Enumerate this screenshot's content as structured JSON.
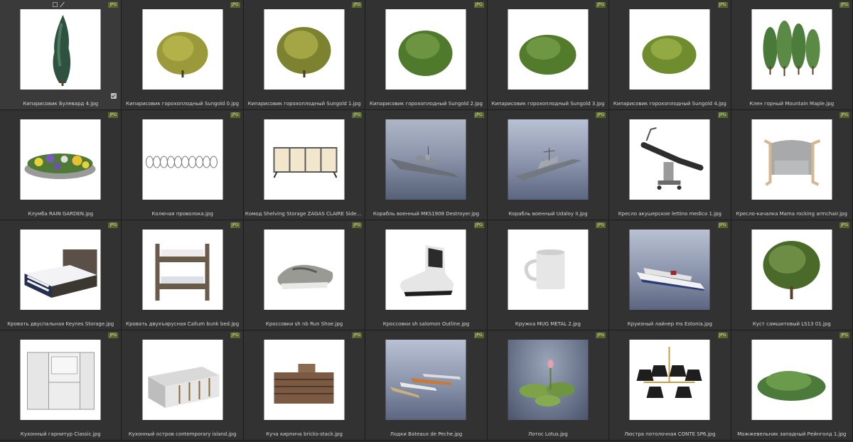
{
  "file_type_badge": "JPG",
  "items": [
    {
      "caption": "Кипарисовик Булевард 4.jpg",
      "icon": "cypress-tree-image"
    },
    {
      "caption": "Кипарисовик горохоплодный Sungold 0.jpg",
      "icon": "shrub-image"
    },
    {
      "caption": "Кипарисовик горохоплодный Sungold 1.jpg",
      "icon": "shrub-image"
    },
    {
      "caption": "Кипарисовик горохоплодный Sungold 2.jpg",
      "icon": "shrub-image"
    },
    {
      "caption": "Кипарисовик горохоплодный Sungold 3.jpg",
      "icon": "shrub-image"
    },
    {
      "caption": "Кипарисовик горохоплодный Sungold 4.jpg",
      "icon": "shrub-image"
    },
    {
      "caption": "Клен горный Mountain Maple.jpg",
      "icon": "maple-trees-image"
    },
    {
      "caption": "Клумба RAIN GARDEN.jpg",
      "icon": "flowerbed-image"
    },
    {
      "caption": "Колючая проволока.jpg",
      "icon": "barbed-wire-image"
    },
    {
      "caption": "Комод Shelving Storage ZAGAS CLAIRE Sideboard.jpg",
      "icon": "sideboard-image"
    },
    {
      "caption": "Корабль военный MKS1908 Destroyer.jpg",
      "icon": "warship-image"
    },
    {
      "caption": "Корабль военный Udaloy II.jpg",
      "icon": "warship-image"
    },
    {
      "caption": "Кресло акушерское lettino medico 1.jpg",
      "icon": "medical-chair-image"
    },
    {
      "caption": "Кресло-качалка Mama rocking armchair.jpg",
      "icon": "armchair-image"
    },
    {
      "caption": "Кровать двуспальная Keynes Storage.jpg",
      "icon": "bed-image"
    },
    {
      "caption": "Кровать двухъярусная Callum bunk bed.jpg",
      "icon": "bunk-bed-image"
    },
    {
      "caption": "Кроссовки sh nb Run Shoe.jpg",
      "icon": "sneaker-image"
    },
    {
      "caption": "Кроссовки sh salomon Outline.jpg",
      "icon": "hiking-boot-image"
    },
    {
      "caption": "Кружка MUG METAL 2.jpg",
      "icon": "mug-image"
    },
    {
      "caption": "Круизный лайнер ms Estonia.jpg",
      "icon": "cruise-ship-image"
    },
    {
      "caption": "Куст самшитовый LS13 01.jpg",
      "icon": "boxwood-tree-image"
    },
    {
      "caption": "Кухонный гарнитур Classic.jpg",
      "icon": "kitchen-cabinet-image"
    },
    {
      "caption": "Кухонный остров contemporary island.jpg",
      "icon": "kitchen-island-image"
    },
    {
      "caption": "Куча кирпича bricks-stack.jpg",
      "icon": "bricks-stack-image"
    },
    {
      "caption": "Лодки Bateaux de Peche.jpg",
      "icon": "boats-image"
    },
    {
      "caption": "Лотос Lotus.jpg",
      "icon": "lotus-image"
    },
    {
      "caption": "Люстра потолочная CONTE SP6.jpg",
      "icon": "chandelier-image"
    },
    {
      "caption": "Можжевельник западный Рейнголд 1.jpg",
      "icon": "juniper-shrub-image"
    }
  ]
}
